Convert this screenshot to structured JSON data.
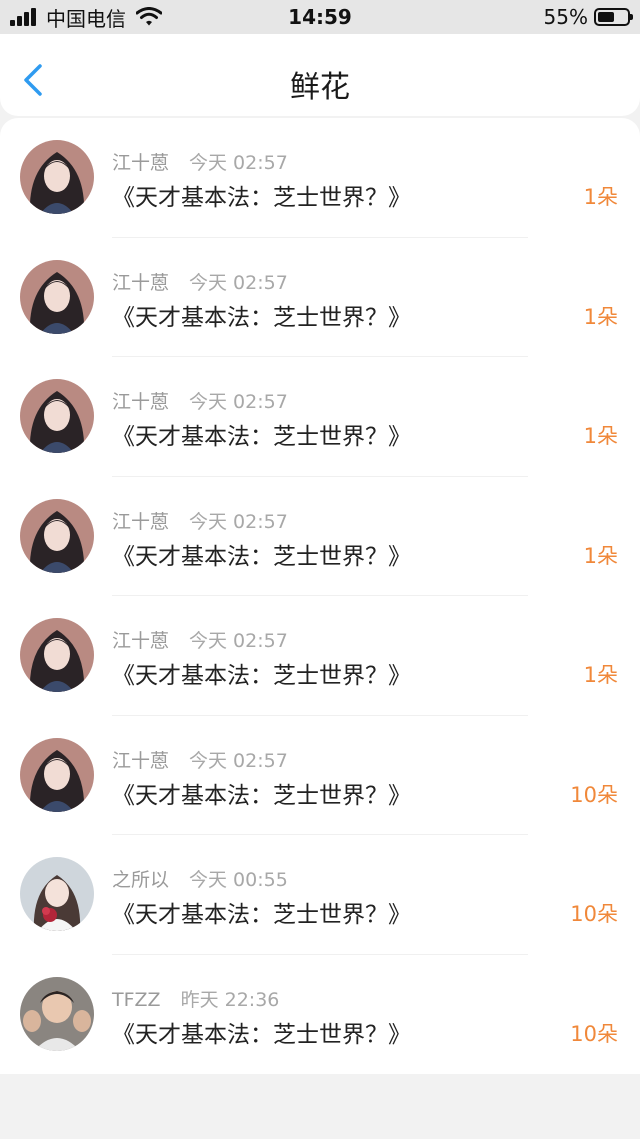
{
  "status_bar": {
    "carrier": "中国电信",
    "time": "14:59",
    "battery_percent": "55%"
  },
  "header": {
    "title": "鲜花"
  },
  "colors": {
    "accent_blue": "#2f9bf0",
    "count_orange": "#f0883a"
  },
  "records": [
    {
      "user": "江十蒽",
      "time": "今天 02:57",
      "book": "《天才基本法：芝士世界？》",
      "count": "1朵",
      "avatar": "avatar-dark-hair"
    },
    {
      "user": "江十蒽",
      "time": "今天 02:57",
      "book": "《天才基本法：芝士世界？》",
      "count": "1朵",
      "avatar": "avatar-dark-hair"
    },
    {
      "user": "江十蒽",
      "time": "今天 02:57",
      "book": "《天才基本法：芝士世界？》",
      "count": "1朵",
      "avatar": "avatar-dark-hair"
    },
    {
      "user": "江十蒽",
      "time": "今天 02:57",
      "book": "《天才基本法：芝士世界？》",
      "count": "1朵",
      "avatar": "avatar-dark-hair"
    },
    {
      "user": "江十蒽",
      "time": "今天 02:57",
      "book": "《天才基本法：芝士世界？》",
      "count": "1朵",
      "avatar": "avatar-dark-hair"
    },
    {
      "user": "江十蒽",
      "time": "今天 02:57",
      "book": "《天才基本法：芝士世界？》",
      "count": "10朵",
      "avatar": "avatar-dark-hair"
    },
    {
      "user": "之所以",
      "time": "今天 00:55",
      "book": "《天才基本法：芝士世界？》",
      "count": "10朵",
      "avatar": "avatar-red-flower"
    },
    {
      "user": "TFZZ",
      "time": "昨天 22:36",
      "book": "《天才基本法：芝士世界？》",
      "count": "10朵",
      "avatar": "avatar-group-photo"
    }
  ]
}
